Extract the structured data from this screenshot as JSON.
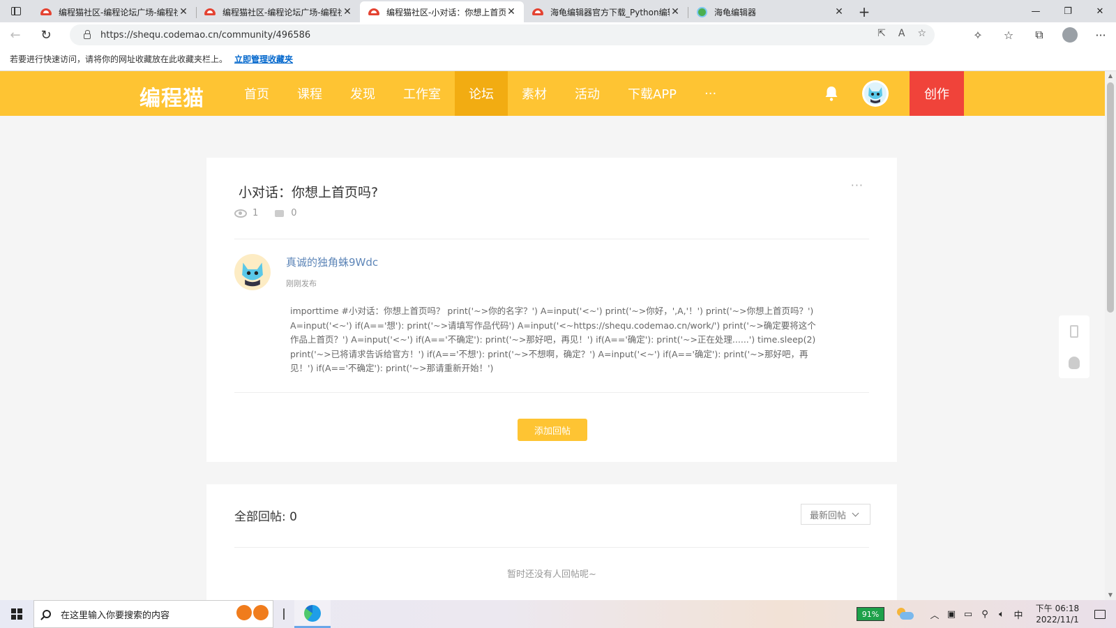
{
  "browser": {
    "tabs": [
      {
        "title": "编程猫社区-编程论坛广场-编程社",
        "favicon": "codemao-icon",
        "active": false
      },
      {
        "title": "编程猫社区-编程论坛广场-编程社",
        "favicon": "codemao-icon",
        "active": false
      },
      {
        "title": "编程猫社区-小对话：你想上首页",
        "favicon": "codemao-icon",
        "active": true
      },
      {
        "title": "海龟编辑器官方下载_Python编辑",
        "favicon": "codemao-icon",
        "active": false
      },
      {
        "title": "海龟编辑器",
        "favicon": "turtle-icon",
        "active": false
      }
    ],
    "url": "https://shequ.codemao.cn/community/496586",
    "favorites_bar": {
      "message": "若要进行快速访问，请将你的网址收藏放在此收藏夹栏上。",
      "link": "立即管理收藏夹"
    }
  },
  "site": {
    "logo": "编程猫",
    "nav": [
      "首页",
      "课程",
      "发现",
      "工作室",
      "论坛",
      "素材",
      "活动",
      "下载APP"
    ],
    "nav_active": "论坛",
    "nav_more": "···",
    "create": "创作",
    "brand_color": "#fec433",
    "create_color": "#f0433a"
  },
  "post": {
    "title": "小对话：你想上首页吗?",
    "views": "1",
    "comments": "0",
    "more": "···",
    "author": "真诚的独角蛛9Wdc",
    "time": "刚刚发布",
    "body": "importtime #小对话：你想上首页吗？ print('~>你的名字？') A=input('<~') print('~>你好，',A,'！') print('~>你想上首页吗？') A=input('<~') if(A=='想'): print('~>请填写作品代码') A=input('<~https://shequ.codemao.cn/work/') print('~>确定要将这个作品上首页？') A=input('<~') if(A=='不确定'): print('~>那好吧，再见！') if(A=='确定'): print('~>正在处理......') time.sleep(2) print('~>已将请求告诉给官方！') if(A=='不想'): print('~>不想啊，确定？') A=input('<~') if(A=='确定'): print('~>那好吧，再见！') if(A=='不确定'): print('~>那请重新开始！')",
    "reply_button": "添加回帖"
  },
  "replies": {
    "title": "全部回帖: 0",
    "sort": "最新回帖",
    "empty": "暂时还没有人回帖呢~"
  },
  "taskbar": {
    "search_placeholder": "在这里输入你要搜索的内容",
    "battery": "91%",
    "ime": "中",
    "time": "下午 06:18",
    "date": "2022/11/1"
  }
}
